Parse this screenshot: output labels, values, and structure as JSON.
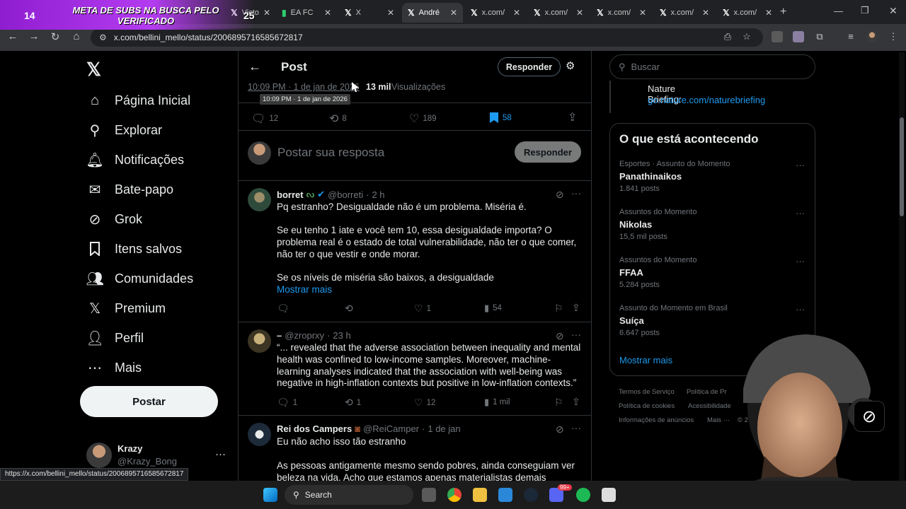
{
  "browser": {
    "tabs": [
      {
        "label": "Victo",
        "icon": "x-logo-icon"
      },
      {
        "label": "EA FC",
        "icon": "futbin-icon"
      },
      {
        "label": "X",
        "icon": "x-logo-icon"
      },
      {
        "label": "André",
        "icon": "x-logo-icon",
        "active": true
      },
      {
        "label": "x.com/",
        "icon": "x-logo-icon"
      },
      {
        "label": "x.com/",
        "icon": "x-logo-icon"
      },
      {
        "label": "x.com/",
        "icon": "x-logo-icon"
      },
      {
        "label": "x.com/",
        "icon": "x-logo-icon"
      },
      {
        "label": "x.com/",
        "icon": "x-logo-icon"
      }
    ],
    "url": "x.com/bellini_mello/status/2006895716585672817",
    "status_url": "https://x.com/bellini_mello/status/2006895716585672817"
  },
  "overlay": {
    "count": "14",
    "text": "META DE SUBS NA BUSCA PELO VERIFICADO",
    "goal": "25"
  },
  "sidebar": {
    "items": [
      {
        "label": "Página Inicial",
        "icon": "home-icon"
      },
      {
        "label": "Explorar",
        "icon": "search-icon"
      },
      {
        "label": "Notificações",
        "icon": "bell-icon"
      },
      {
        "label": "Bate-papo",
        "icon": "mail-icon"
      },
      {
        "label": "Grok",
        "icon": "grok-icon"
      },
      {
        "label": "Itens salvos",
        "icon": "bookmark-icon"
      },
      {
        "label": "Comunidades",
        "icon": "communities-icon"
      },
      {
        "label": "Premium",
        "icon": "x-logo-icon"
      },
      {
        "label": "Perfil",
        "icon": "person-icon"
      },
      {
        "label": "Mais",
        "icon": "more-circle-icon"
      }
    ],
    "post_button": "Postar",
    "account": {
      "name": "Krazy",
      "handle": "@Krazy_Bong"
    }
  },
  "header": {
    "title": "Post",
    "reply_button": "Responder"
  },
  "post": {
    "timestamp": "10:09 PM · 1 de jan de 2026",
    "views_count": "13 mil",
    "views_label": "Visualizações",
    "tooltip": "10:09 PM · 1 de jan de 2026",
    "replies": "12",
    "reposts": "8",
    "likes": "189",
    "bookmarks": "58"
  },
  "composer": {
    "placeholder": "Postar sua resposta",
    "button": "Responder"
  },
  "replies": [
    {
      "name": "borret",
      "handle": "@borreti",
      "time": "2 h",
      "verified": true,
      "paragraphs": [
        "Pq estranho? Desigualdade não é um problema. Miséria é.",
        "Se eu tenho 1 iate e você tem 10, essa desigualdade importa?  O problema real é o estado de total vulnerabilidade, não ter o que comer, não ter o que vestir e onde morar.",
        "Se os níveis de miséria são baixos, a desigualdade"
      ],
      "show_more": "Mostrar mais",
      "replies": "",
      "reposts": "",
      "likes": "1",
      "views": "54"
    },
    {
      "name": "–",
      "handle": "@zroprxy",
      "time": "23 h",
      "paragraphs": [
        "“... revealed that the adverse association between inequality and mental health was confined to low-income samples. Moreover, machine-learning analyses indicated that the association with well-being was negative in high-inflation contexts but positive in low-inflation contexts.”"
      ],
      "replies": "1",
      "reposts": "1",
      "likes": "12",
      "views": "1 mil"
    },
    {
      "name": "Rei dos Campers",
      "handle": "@ReiCamper",
      "time": "1 de jan",
      "paragraphs": [
        "Eu não acho isso tão estranho",
        "As pessoas antigamente mesmo sendo pobres, ainda conseguiam ver beleza na vida. Acho que estamos apenas materialistas demais"
      ]
    }
  ],
  "right": {
    "search_placeholder": "Buscar",
    "nature": {
      "title": "Nature Briefing:",
      "link": "go.nature.com/naturebriefing"
    },
    "trends_title": "O que está acontecendo",
    "trends": [
      {
        "meta": "Esportes · Assunto do Momento",
        "name": "Panathinaikos",
        "count": "1.841 posts"
      },
      {
        "meta": "Assuntos do Momento",
        "name": "Nikolas",
        "count": "15,5 mil posts"
      },
      {
        "meta": "Assuntos do Momento",
        "name": "FFAA",
        "count": "5.284 posts"
      },
      {
        "meta": "Assunto do Momento em Brasil",
        "name": "Suíça",
        "count": "6.647 posts"
      }
    ],
    "show_more": "Mostrar mais",
    "footer": [
      "Termos de Serviço",
      "Política de Pr",
      "Política de cookies",
      "Acessibilidade",
      "Informações de anúncios",
      "Mais ···",
      "© 2"
    ]
  },
  "taskbar": {
    "search_label": "Search",
    "discord_badge": "99+"
  },
  "colors": {
    "accent": "#1d9bf0",
    "banner": "#b43cf0"
  }
}
